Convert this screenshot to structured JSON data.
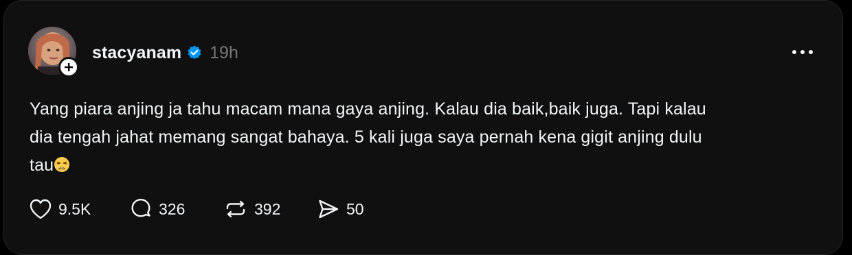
{
  "post": {
    "author": {
      "username": "stacyanam",
      "verified": true,
      "avatar_icon": "avatar-photo",
      "follow_icon": "plus-icon"
    },
    "timestamp": "19h",
    "text_line1": "Yang piara anjing ja tahu macam mana gaya anjing. Kalau dia baik,baik juga. Tapi kalau",
    "text_line2": "dia tengah jahat memang sangat bahaya. 5 kali juga saya pernah kena gigit anjing dulu",
    "text_line3": "tau",
    "text_emoji": "weary-face-emoji",
    "more_icon": "more-horizontal-icon"
  },
  "actions": {
    "likes": {
      "icon": "heart-icon",
      "count": "9.5K"
    },
    "replies": {
      "icon": "comment-icon",
      "count": "326"
    },
    "reposts": {
      "icon": "repost-icon",
      "count": "392"
    },
    "shares": {
      "icon": "send-icon",
      "count": "50"
    }
  },
  "colors": {
    "background": "#000000",
    "card": "#101010",
    "text": "#f3f5f7",
    "muted": "#777777",
    "verified": "#0095f6"
  }
}
